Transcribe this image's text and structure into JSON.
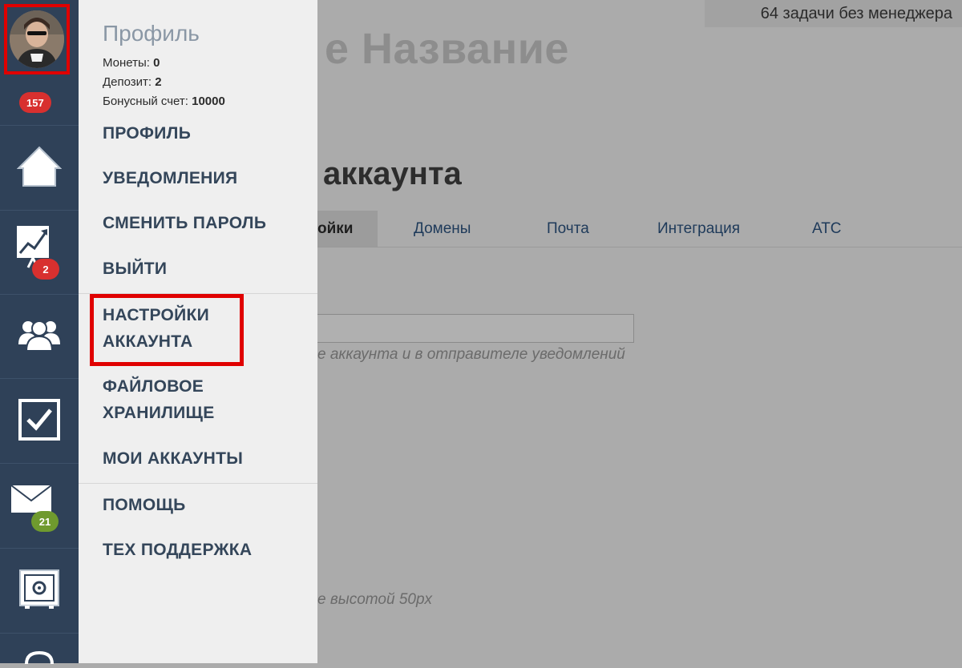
{
  "background": {
    "tasks_banner": "64 задачи без менеджера",
    "title_fragment": "е Название",
    "heading_fragment": "аккаунта",
    "tabs": [
      {
        "label": "ойки",
        "active": true
      },
      {
        "label": "Домены",
        "active": false
      },
      {
        "label": "Почта",
        "active": false
      },
      {
        "label": "Интеграция",
        "active": false
      },
      {
        "label": "АТС",
        "active": false
      }
    ],
    "hint_1": "е аккаунта и в отправителе уведомлений",
    "hint_2": "е высотой 50px"
  },
  "sidebar": {
    "items": [
      {
        "name": "home",
        "icon": "home-icon"
      },
      {
        "name": "stats",
        "icon": "chart-icon",
        "badge": "2",
        "badge_color": "#d8302f"
      },
      {
        "name": "users",
        "icon": "users-icon"
      },
      {
        "name": "tasks",
        "icon": "checkbox-icon"
      },
      {
        "name": "mail",
        "icon": "mail-icon",
        "badge": "21",
        "badge_color": "#6f9a2e"
      },
      {
        "name": "safe",
        "icon": "safe-icon"
      }
    ],
    "notifications_badge": "157"
  },
  "menu": {
    "title": "Профиль",
    "coins_label": "Монеты: ",
    "coins_value": "0",
    "deposit_label": "Депозит: ",
    "deposit_value": "2",
    "bonus_label": "Бонусный счет: ",
    "bonus_value": "10000",
    "items": {
      "profile": "ПРОФИЛЬ",
      "notifications": "УВЕДОМЛЕНИЯ",
      "change_password": "СМЕНИТЬ ПАРОЛЬ",
      "logout": "ВЫЙТИ",
      "account_settings_1": "НАСТРОЙКИ",
      "account_settings_2": "АККАУНТА",
      "file_storage_1": "ФАЙЛОВОЕ",
      "file_storage_2": "ХРАНИЛИЩЕ",
      "my_accounts": "МОИ АККАУНТЫ",
      "help": "ПОМОЩЬ",
      "support": "ТЕХ ПОДДЕРЖКА"
    }
  },
  "colors": {
    "sidebar_bg": "#2f4158",
    "menu_bg": "#efefef",
    "highlight": "#e00000",
    "menu_text": "#34465a"
  }
}
